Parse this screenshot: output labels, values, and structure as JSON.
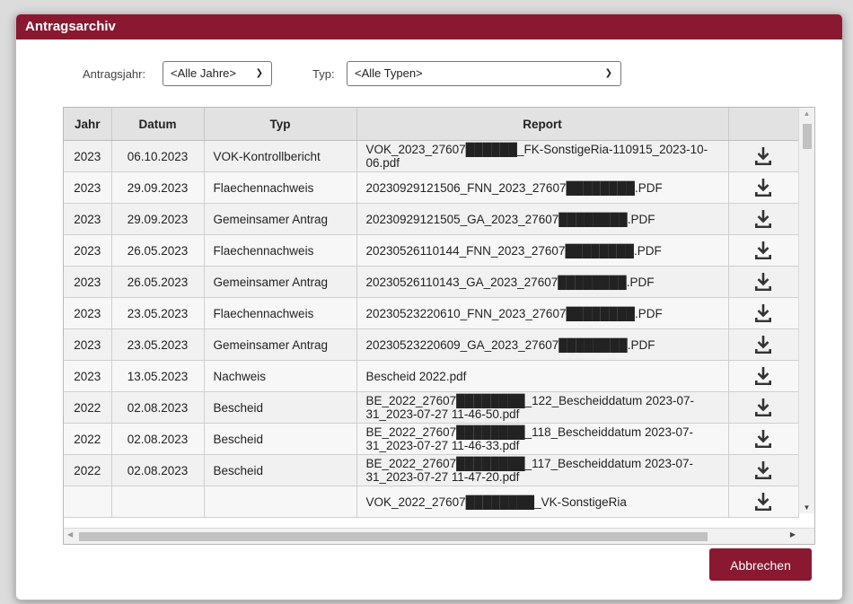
{
  "dialog": {
    "title": "Antragsarchiv"
  },
  "filters": {
    "year_label": "Antragsjahr:",
    "year_value": "<Alle Jahre>",
    "type_label": "Typ:",
    "type_value": "<Alle Typen>"
  },
  "table": {
    "headers": [
      "Jahr",
      "Datum",
      "Typ",
      "Report",
      ""
    ],
    "rows": [
      {
        "jahr": "2023",
        "datum": "06.10.2023",
        "typ": "VOK-Kontrollbericht",
        "report": "VOK_2023_27607██████_FK-SonstigeRia-110915_2023-10-06.pdf"
      },
      {
        "jahr": "2023",
        "datum": "29.09.2023",
        "typ": "Flaechennachweis",
        "report": "20230929121506_FNN_2023_27607████████.PDF"
      },
      {
        "jahr": "2023",
        "datum": "29.09.2023",
        "typ": "Gemeinsamer Antrag",
        "report": "20230929121505_GA_2023_27607████████.PDF"
      },
      {
        "jahr": "2023",
        "datum": "26.05.2023",
        "typ": "Flaechennachweis",
        "report": "20230526110144_FNN_2023_27607████████.PDF"
      },
      {
        "jahr": "2023",
        "datum": "26.05.2023",
        "typ": "Gemeinsamer Antrag",
        "report": "20230526110143_GA_2023_27607████████.PDF"
      },
      {
        "jahr": "2023",
        "datum": "23.05.2023",
        "typ": "Flaechennachweis",
        "report": "20230523220610_FNN_2023_27607████████.PDF"
      },
      {
        "jahr": "2023",
        "datum": "23.05.2023",
        "typ": "Gemeinsamer Antrag",
        "report": "20230523220609_GA_2023_27607████████.PDF"
      },
      {
        "jahr": "2023",
        "datum": "13.05.2023",
        "typ": "Nachweis",
        "report": "Bescheid 2022.pdf"
      },
      {
        "jahr": "2022",
        "datum": "02.08.2023",
        "typ": "Bescheid",
        "report": "BE_2022_27607████████_122_Bescheiddatum 2023-07-31_2023-07-27 11-46-50.pdf"
      },
      {
        "jahr": "2022",
        "datum": "02.08.2023",
        "typ": "Bescheid",
        "report": "BE_2022_27607████████_118_Bescheiddatum 2023-07-31_2023-07-27 11-46-33.pdf"
      },
      {
        "jahr": "2022",
        "datum": "02.08.2023",
        "typ": "Bescheid",
        "report": "BE_2022_27607████████_117_Bescheiddatum 2023-07-31_2023-07-27 11-47-20.pdf"
      },
      {
        "jahr": "",
        "datum": "",
        "typ": "",
        "report": "VOK_2022_27607████████_VK-SonstigeRia"
      }
    ],
    "row_action_icon": "download-icon"
  },
  "footer": {
    "cancel_label": "Abbrechen"
  },
  "colors": {
    "accent": "#8a1830",
    "header_bg": "#e2e2e2"
  }
}
